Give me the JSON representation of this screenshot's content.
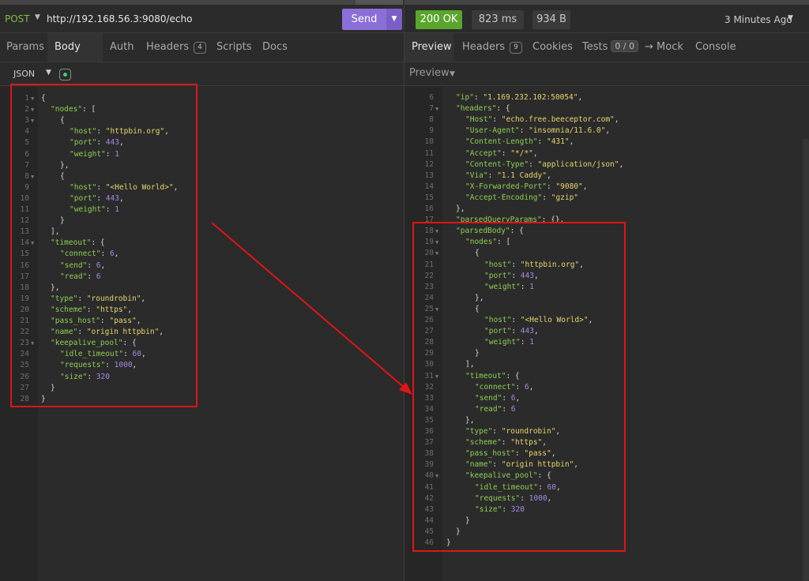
{
  "request": {
    "method": "POST",
    "url": "http://192.168.56.3:9080/echo",
    "send_label": "Send",
    "tabs": [
      {
        "label": "Params"
      },
      {
        "label": "Body"
      },
      {
        "label": "Auth"
      },
      {
        "label": "Headers",
        "badge": "4"
      },
      {
        "label": "Scripts"
      },
      {
        "label": "Docs"
      }
    ],
    "body_type": "JSON"
  },
  "response": {
    "status": "200 OK",
    "time": "823 ms",
    "size": "934 B",
    "time_ago": "3 Minutes Ago",
    "tabs": [
      {
        "label": "Preview"
      },
      {
        "label": "Headers",
        "badge": "9"
      },
      {
        "label": "Cookies"
      },
      {
        "label": "Tests",
        "badge": "0 / 0"
      },
      {
        "label": "Mock"
      },
      {
        "label": "Console"
      }
    ],
    "preview_label": "Preview"
  },
  "colors": {
    "accent": "#8b6fd8",
    "ok": "#5aa52c",
    "highlight_box": "#e01515",
    "json_key": "#8ecf52",
    "json_string": "#e8d56b",
    "json_number": "#a48be0"
  },
  "left_lines": [
    {
      "n": "1",
      "fold": true,
      "t": [
        [
          "p",
          "{"
        ]
      ]
    },
    {
      "n": "2",
      "fold": true,
      "i": 1,
      "t": [
        [
          "k",
          "\"nodes\""
        ],
        [
          "p",
          ": ["
        ]
      ]
    },
    {
      "n": "3",
      "fold": true,
      "i": 2,
      "t": [
        [
          "p",
          "{"
        ]
      ]
    },
    {
      "n": "4",
      "i": 3,
      "t": [
        [
          "k",
          "\"host\""
        ],
        [
          "p",
          ": "
        ],
        [
          "s",
          "\"httpbin.org\""
        ],
        [
          "p",
          ","
        ]
      ]
    },
    {
      "n": "5",
      "i": 3,
      "t": [
        [
          "k",
          "\"port\""
        ],
        [
          "p",
          ": "
        ],
        [
          "n",
          "443"
        ],
        [
          "p",
          ","
        ]
      ]
    },
    {
      "n": "6",
      "i": 3,
      "t": [
        [
          "k",
          "\"weight\""
        ],
        [
          "p",
          ": "
        ],
        [
          "n",
          "1"
        ]
      ]
    },
    {
      "n": "7",
      "i": 2,
      "t": [
        [
          "p",
          "},"
        ]
      ]
    },
    {
      "n": "8",
      "fold": true,
      "i": 2,
      "t": [
        [
          "p",
          "{"
        ]
      ]
    },
    {
      "n": "9",
      "i": 3,
      "t": [
        [
          "k",
          "\"host\""
        ],
        [
          "p",
          ": "
        ],
        [
          "s",
          "\"<Hello World>\""
        ],
        [
          "p",
          ","
        ]
      ]
    },
    {
      "n": "10",
      "i": 3,
      "t": [
        [
          "k",
          "\"port\""
        ],
        [
          "p",
          ": "
        ],
        [
          "n",
          "443"
        ],
        [
          "p",
          ","
        ]
      ]
    },
    {
      "n": "11",
      "i": 3,
      "t": [
        [
          "k",
          "\"weight\""
        ],
        [
          "p",
          ": "
        ],
        [
          "n",
          "1"
        ]
      ]
    },
    {
      "n": "12",
      "i": 2,
      "t": [
        [
          "p",
          "}"
        ]
      ]
    },
    {
      "n": "13",
      "i": 1,
      "t": [
        [
          "p",
          "],"
        ]
      ]
    },
    {
      "n": "14",
      "fold": true,
      "i": 1,
      "t": [
        [
          "k",
          "\"timeout\""
        ],
        [
          "p",
          ": {"
        ]
      ]
    },
    {
      "n": "15",
      "i": 2,
      "t": [
        [
          "k",
          "\"connect\""
        ],
        [
          "p",
          ": "
        ],
        [
          "n",
          "6"
        ],
        [
          "p",
          ","
        ]
      ]
    },
    {
      "n": "16",
      "i": 2,
      "t": [
        [
          "k",
          "\"send\""
        ],
        [
          "p",
          ": "
        ],
        [
          "n",
          "6"
        ],
        [
          "p",
          ","
        ]
      ]
    },
    {
      "n": "17",
      "i": 2,
      "t": [
        [
          "k",
          "\"read\""
        ],
        [
          "p",
          ": "
        ],
        [
          "n",
          "6"
        ]
      ]
    },
    {
      "n": "18",
      "i": 1,
      "t": [
        [
          "p",
          "},"
        ]
      ]
    },
    {
      "n": "19",
      "i": 1,
      "t": [
        [
          "k",
          "\"type\""
        ],
        [
          "p",
          ": "
        ],
        [
          "s",
          "\"roundrobin\""
        ],
        [
          "p",
          ","
        ]
      ]
    },
    {
      "n": "20",
      "i": 1,
      "t": [
        [
          "k",
          "\"scheme\""
        ],
        [
          "p",
          ": "
        ],
        [
          "s",
          "\"https\""
        ],
        [
          "p",
          ","
        ]
      ]
    },
    {
      "n": "21",
      "i": 1,
      "t": [
        [
          "k",
          "\"pass_host\""
        ],
        [
          "p",
          ": "
        ],
        [
          "s",
          "\"pass\""
        ],
        [
          "p",
          ","
        ]
      ]
    },
    {
      "n": "22",
      "i": 1,
      "t": [
        [
          "k",
          "\"name\""
        ],
        [
          "p",
          ": "
        ],
        [
          "s",
          "\"origin httpbin\""
        ],
        [
          "p",
          ","
        ]
      ]
    },
    {
      "n": "23",
      "fold": true,
      "i": 1,
      "t": [
        [
          "k",
          "\"keepalive_pool\""
        ],
        [
          "p",
          ": {"
        ]
      ]
    },
    {
      "n": "24",
      "i": 2,
      "t": [
        [
          "k",
          "\"idle_timeout\""
        ],
        [
          "p",
          ": "
        ],
        [
          "n",
          "60"
        ],
        [
          "p",
          ","
        ]
      ]
    },
    {
      "n": "25",
      "i": 2,
      "t": [
        [
          "k",
          "\"requests\""
        ],
        [
          "p",
          ": "
        ],
        [
          "n",
          "1000"
        ],
        [
          "p",
          ","
        ]
      ]
    },
    {
      "n": "26",
      "i": 2,
      "t": [
        [
          "k",
          "\"size\""
        ],
        [
          "p",
          ": "
        ],
        [
          "n",
          "320"
        ]
      ]
    },
    {
      "n": "27",
      "i": 1,
      "t": [
        [
          "p",
          "}"
        ]
      ]
    },
    {
      "n": "28",
      "t": [
        [
          "p",
          "}"
        ]
      ]
    }
  ],
  "right_lines": [
    {
      "n": "6",
      "i": 1,
      "t": [
        [
          "k",
          "\"ip\""
        ],
        [
          "p",
          ": "
        ],
        [
          "s",
          "\"1.169.232.102:50054\""
        ],
        [
          "p",
          ","
        ]
      ]
    },
    {
      "n": "7",
      "fold": true,
      "i": 1,
      "t": [
        [
          "k",
          "\"headers\""
        ],
        [
          "p",
          ": {"
        ]
      ]
    },
    {
      "n": "8",
      "i": 2,
      "t": [
        [
          "k",
          "\"Host\""
        ],
        [
          "p",
          ": "
        ],
        [
          "s",
          "\"echo.free.beeceptor.com\""
        ],
        [
          "p",
          ","
        ]
      ]
    },
    {
      "n": "9",
      "i": 2,
      "t": [
        [
          "k",
          "\"User-Agent\""
        ],
        [
          "p",
          ": "
        ],
        [
          "s",
          "\"insomnia/11.6.0\""
        ],
        [
          "p",
          ","
        ]
      ]
    },
    {
      "n": "10",
      "i": 2,
      "t": [
        [
          "k",
          "\"Content-Length\""
        ],
        [
          "p",
          ": "
        ],
        [
          "s",
          "\"431\""
        ],
        [
          "p",
          ","
        ]
      ]
    },
    {
      "n": "11",
      "i": 2,
      "t": [
        [
          "k",
          "\"Accept\""
        ],
        [
          "p",
          ": "
        ],
        [
          "s",
          "\"*/*\""
        ],
        [
          "p",
          ","
        ]
      ]
    },
    {
      "n": "12",
      "i": 2,
      "t": [
        [
          "k",
          "\"Content-Type\""
        ],
        [
          "p",
          ": "
        ],
        [
          "s",
          "\"application/json\""
        ],
        [
          "p",
          ","
        ]
      ]
    },
    {
      "n": "13",
      "i": 2,
      "t": [
        [
          "k",
          "\"Via\""
        ],
        [
          "p",
          ": "
        ],
        [
          "s",
          "\"1.1 Caddy\""
        ],
        [
          "p",
          ","
        ]
      ]
    },
    {
      "n": "14",
      "i": 2,
      "t": [
        [
          "k",
          "\"X-Forwarded-Port\""
        ],
        [
          "p",
          ": "
        ],
        [
          "s",
          "\"9080\""
        ],
        [
          "p",
          ","
        ]
      ]
    },
    {
      "n": "15",
      "i": 2,
      "t": [
        [
          "k",
          "\"Accept-Encoding\""
        ],
        [
          "p",
          ": "
        ],
        [
          "s",
          "\"gzip\""
        ]
      ]
    },
    {
      "n": "16",
      "i": 1,
      "t": [
        [
          "p",
          "},"
        ]
      ]
    },
    {
      "n": "17",
      "i": 1,
      "t": [
        [
          "k",
          "\"parsedQueryParams\""
        ],
        [
          "p",
          ": {},"
        ]
      ]
    },
    {
      "n": "18",
      "fold": true,
      "i": 1,
      "t": [
        [
          "k",
          "\"parsedBody\""
        ],
        [
          "p",
          ": {"
        ]
      ]
    },
    {
      "n": "19",
      "fold": true,
      "i": 2,
      "t": [
        [
          "k",
          "\"nodes\""
        ],
        [
          "p",
          ": ["
        ]
      ]
    },
    {
      "n": "20",
      "fold": true,
      "i": 3,
      "t": [
        [
          "p",
          "{"
        ]
      ]
    },
    {
      "n": "21",
      "i": 4,
      "t": [
        [
          "k",
          "\"host\""
        ],
        [
          "p",
          ": "
        ],
        [
          "s",
          "\"httpbin.org\""
        ],
        [
          "p",
          ","
        ]
      ]
    },
    {
      "n": "22",
      "i": 4,
      "t": [
        [
          "k",
          "\"port\""
        ],
        [
          "p",
          ": "
        ],
        [
          "n",
          "443"
        ],
        [
          "p",
          ","
        ]
      ]
    },
    {
      "n": "23",
      "i": 4,
      "t": [
        [
          "k",
          "\"weight\""
        ],
        [
          "p",
          ": "
        ],
        [
          "n",
          "1"
        ]
      ]
    },
    {
      "n": "24",
      "i": 3,
      "t": [
        [
          "p",
          "},"
        ]
      ]
    },
    {
      "n": "25",
      "fold": true,
      "i": 3,
      "t": [
        [
          "p",
          "{"
        ]
      ]
    },
    {
      "n": "26",
      "i": 4,
      "t": [
        [
          "k",
          "\"host\""
        ],
        [
          "p",
          ": "
        ],
        [
          "s",
          "\"<Hello World>\""
        ],
        [
          "p",
          ","
        ]
      ]
    },
    {
      "n": "27",
      "i": 4,
      "t": [
        [
          "k",
          "\"port\""
        ],
        [
          "p",
          ": "
        ],
        [
          "n",
          "443"
        ],
        [
          "p",
          ","
        ]
      ]
    },
    {
      "n": "28",
      "i": 4,
      "t": [
        [
          "k",
          "\"weight\""
        ],
        [
          "p",
          ": "
        ],
        [
          "n",
          "1"
        ]
      ]
    },
    {
      "n": "29",
      "i": 3,
      "t": [
        [
          "p",
          "}"
        ]
      ]
    },
    {
      "n": "30",
      "i": 2,
      "t": [
        [
          "p",
          "],"
        ]
      ]
    },
    {
      "n": "31",
      "fold": true,
      "i": 2,
      "t": [
        [
          "k",
          "\"timeout\""
        ],
        [
          "p",
          ": {"
        ]
      ]
    },
    {
      "n": "32",
      "i": 3,
      "t": [
        [
          "k",
          "\"connect\""
        ],
        [
          "p",
          ": "
        ],
        [
          "n",
          "6"
        ],
        [
          "p",
          ","
        ]
      ]
    },
    {
      "n": "33",
      "i": 3,
      "t": [
        [
          "k",
          "\"send\""
        ],
        [
          "p",
          ": "
        ],
        [
          "n",
          "6"
        ],
        [
          "p",
          ","
        ]
      ]
    },
    {
      "n": "34",
      "i": 3,
      "t": [
        [
          "k",
          "\"read\""
        ],
        [
          "p",
          ": "
        ],
        [
          "n",
          "6"
        ]
      ]
    },
    {
      "n": "35",
      "i": 2,
      "t": [
        [
          "p",
          "},"
        ]
      ]
    },
    {
      "n": "36",
      "i": 2,
      "t": [
        [
          "k",
          "\"type\""
        ],
        [
          "p",
          ": "
        ],
        [
          "s",
          "\"roundrobin\""
        ],
        [
          "p",
          ","
        ]
      ]
    },
    {
      "n": "37",
      "i": 2,
      "t": [
        [
          "k",
          "\"scheme\""
        ],
        [
          "p",
          ": "
        ],
        [
          "s",
          "\"https\""
        ],
        [
          "p",
          ","
        ]
      ]
    },
    {
      "n": "38",
      "i": 2,
      "t": [
        [
          "k",
          "\"pass_host\""
        ],
        [
          "p",
          ": "
        ],
        [
          "s",
          "\"pass\""
        ],
        [
          "p",
          ","
        ]
      ]
    },
    {
      "n": "39",
      "i": 2,
      "t": [
        [
          "k",
          "\"name\""
        ],
        [
          "p",
          ": "
        ],
        [
          "s",
          "\"origin httpbin\""
        ],
        [
          "p",
          ","
        ]
      ]
    },
    {
      "n": "40",
      "fold": true,
      "i": 2,
      "t": [
        [
          "k",
          "\"keepalive_pool\""
        ],
        [
          "p",
          ": {"
        ]
      ]
    },
    {
      "n": "41",
      "i": 3,
      "t": [
        [
          "k",
          "\"idle_timeout\""
        ],
        [
          "p",
          ": "
        ],
        [
          "n",
          "60"
        ],
        [
          "p",
          ","
        ]
      ]
    },
    {
      "n": "42",
      "i": 3,
      "t": [
        [
          "k",
          "\"requests\""
        ],
        [
          "p",
          ": "
        ],
        [
          "n",
          "1000"
        ],
        [
          "p",
          ","
        ]
      ]
    },
    {
      "n": "43",
      "i": 3,
      "t": [
        [
          "k",
          "\"size\""
        ],
        [
          "p",
          ": "
        ],
        [
          "n",
          "320"
        ]
      ]
    },
    {
      "n": "44",
      "i": 2,
      "t": [
        [
          "p",
          "}"
        ]
      ]
    },
    {
      "n": "45",
      "i": 1,
      "t": [
        [
          "p",
          "}"
        ]
      ]
    },
    {
      "n": "46",
      "t": [
        [
          "p",
          "}"
        ]
      ]
    }
  ]
}
